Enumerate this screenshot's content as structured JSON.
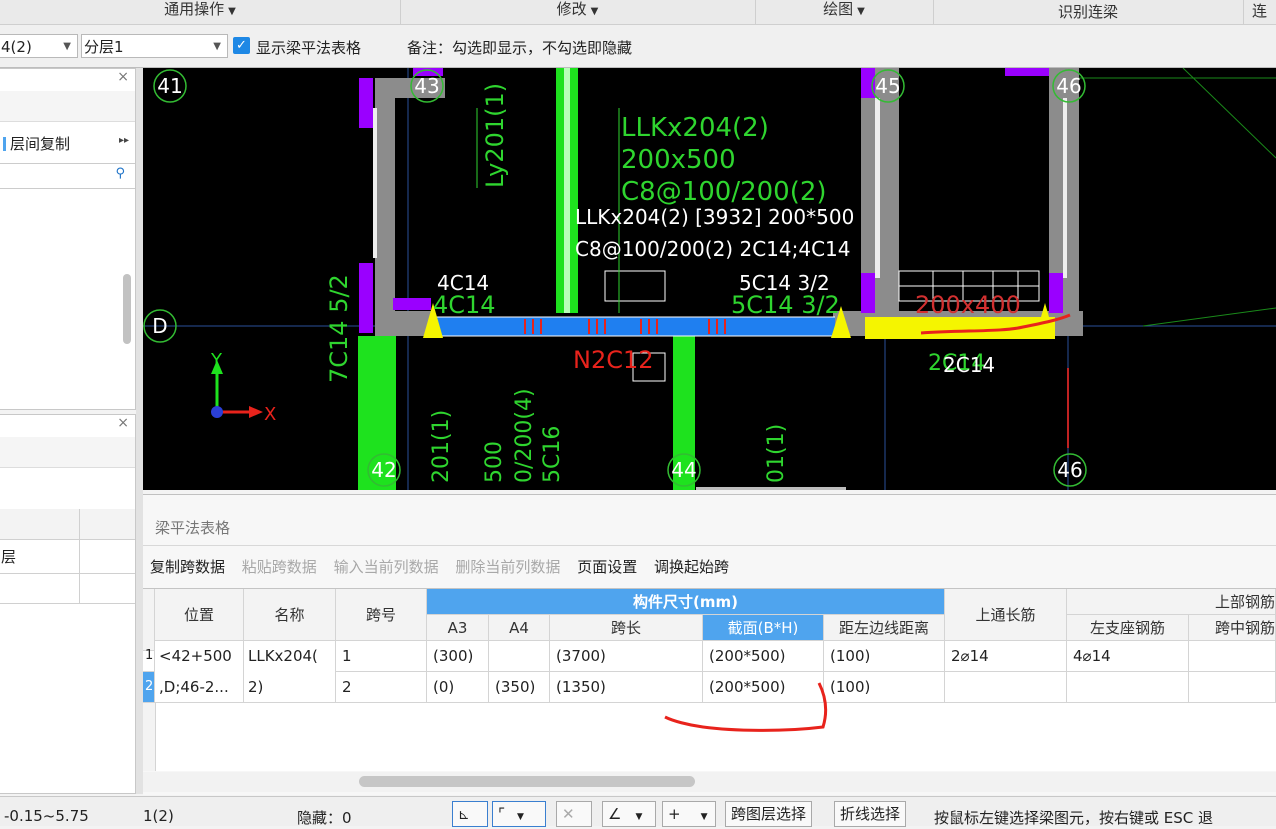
{
  "ribbon": {
    "groups": [
      {
        "label": "通用操作"
      },
      {
        "label": "修改"
      },
      {
        "label": "绘图"
      },
      {
        "label": "识别连梁"
      },
      {
        "label": "连"
      }
    ]
  },
  "toolbar": {
    "floor_combo": "4(2)",
    "layer_combo": "分层1",
    "show_table_label": "显示梁平法表格",
    "show_table_checked": true,
    "remark": "备注：勾选即显示，不勾选即隐藏"
  },
  "left_panel_top": {
    "copy_label": "层间复制",
    "expand_glyph": "▸▸",
    "search_glyph": "🔍"
  },
  "left_panel_bottom": {
    "row_label": "层"
  },
  "canvas": {
    "axis_labels": [
      "41",
      "43",
      "45",
      "46",
      "42",
      "44",
      "46",
      "D"
    ],
    "beam_label_1": "LLKx204(2)",
    "beam_label_2": "200x500",
    "beam_label_3": "C8@100/200(2)",
    "tooltip_line1": "LLKx204(2) [3932] 200*500",
    "tooltip_line2": "C8@100/200(2) 2C14;4C14",
    "rebar_left": "4C14",
    "rebar_left_ghost": "4C14",
    "rebar_right": "5C14 3/2",
    "rebar_right_ghost": "5C14 3/2",
    "vert_label": "Ly201(1)",
    "side_label": "7C14 5/2",
    "waist_label": "N2C12",
    "section_ghost": "200x400",
    "bottom_rebar": "2C14",
    "bottom_rebar_ghost": "2C14",
    "lower_labels": [
      "201(1)",
      "500",
      "0/200(4)",
      "5C16",
      "01(1)"
    ],
    "ucs_y": "Y",
    "ucs_x": "X"
  },
  "table_panel": {
    "title": "梁平法表格",
    "actions": [
      {
        "label": "复制跨数据",
        "enabled": true
      },
      {
        "label": "粘贴跨数据",
        "enabled": false
      },
      {
        "label": "输入当前列数据",
        "enabled": false
      },
      {
        "label": "删除当前列数据",
        "enabled": false
      },
      {
        "label": "页面设置",
        "enabled": true
      },
      {
        "label": "调换起始跨",
        "enabled": true
      }
    ],
    "headers": {
      "position": "位置",
      "name": "名称",
      "span_no": "跨号",
      "group_size": "构件尺寸(mm)",
      "a3": "A3",
      "a4": "A4",
      "span_len": "跨长",
      "section": "截面(B*H)",
      "left_dist": "距左边线距离",
      "top_through": "上通长筋",
      "group_top": "上部钢筋",
      "left_support": "左支座钢筋",
      "mid_span": "跨中钢筋"
    },
    "rows": [
      {
        "index": "1",
        "position": "<42+500",
        "name": "LLKx204(",
        "span": "1",
        "a3": "(300)",
        "a4": "",
        "span_len": "(3700)",
        "section": "(200*500)",
        "left_dist": "(100)",
        "top_through": "2⌀14",
        "left_support": "4⌀14",
        "mid_span": ""
      },
      {
        "index": "2",
        "position": ",D;46-2...",
        "name": "2)",
        "span": "2",
        "a3": "(0)",
        "a4": "(350)",
        "span_len": "(1350)",
        "section": "(200*500)",
        "left_dist": "(100)",
        "top_through": "",
        "left_support": "",
        "mid_span": ""
      }
    ]
  },
  "status": {
    "elevation": "-0.15~5.75",
    "floor": "1(2)",
    "hidden": "隐藏：0",
    "btn_cross_layer": "跨图层选择",
    "btn_polyline": "折线选择",
    "hint": "按鼠标左键选择梁图元，按右键或 ESC 退"
  },
  "colors": {
    "accent": "#4fa4ee",
    "checkbox": "#1e88e5",
    "canvas_bg": "#000000",
    "beam_blue": "#1f7ff0",
    "wall_green": "#1ee21e",
    "purple": "#9a00ff",
    "yellow": "#f5f500",
    "annotation_red": "#e8231c"
  }
}
